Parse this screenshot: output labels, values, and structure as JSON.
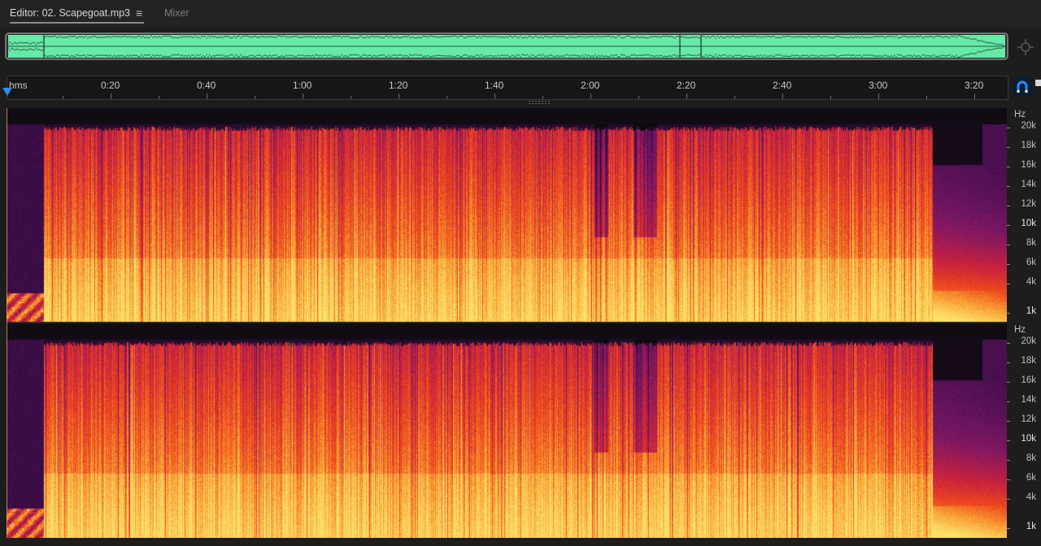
{
  "tabs": {
    "editor_label": "Editor: 02. Scapegoat.mp3",
    "menu_glyph": "≡",
    "mixer_label": "Mixer"
  },
  "overview": {
    "waveform_color": "#66eaa8",
    "frame_color": "#8c8c8c",
    "zoom_icon": "zoom-navigator-icon"
  },
  "timeline": {
    "unit_label": "hms",
    "ticks": [
      "0:20",
      "0:40",
      "1:00",
      "1:20",
      "1:40",
      "2:00",
      "2:20",
      "2:40",
      "3:00",
      "3:20"
    ],
    "playhead_color": "#2d8ceb",
    "snap_icon": "snap-magnet-icon"
  },
  "spectral": {
    "unit": "Hz",
    "freq_labels": [
      "20k",
      "18k",
      "16k",
      "14k",
      "12k",
      "10k",
      "8k",
      "6k",
      "4k",
      "1k"
    ],
    "colormap": [
      "#0b0b0b",
      "#3d0d4a",
      "#7a1764",
      "#c8213e",
      "#ef4a1c",
      "#f8a234",
      "#fde06a"
    ],
    "channels": [
      {
        "name": "channel-1"
      },
      {
        "name": "channel-2"
      }
    ]
  }
}
